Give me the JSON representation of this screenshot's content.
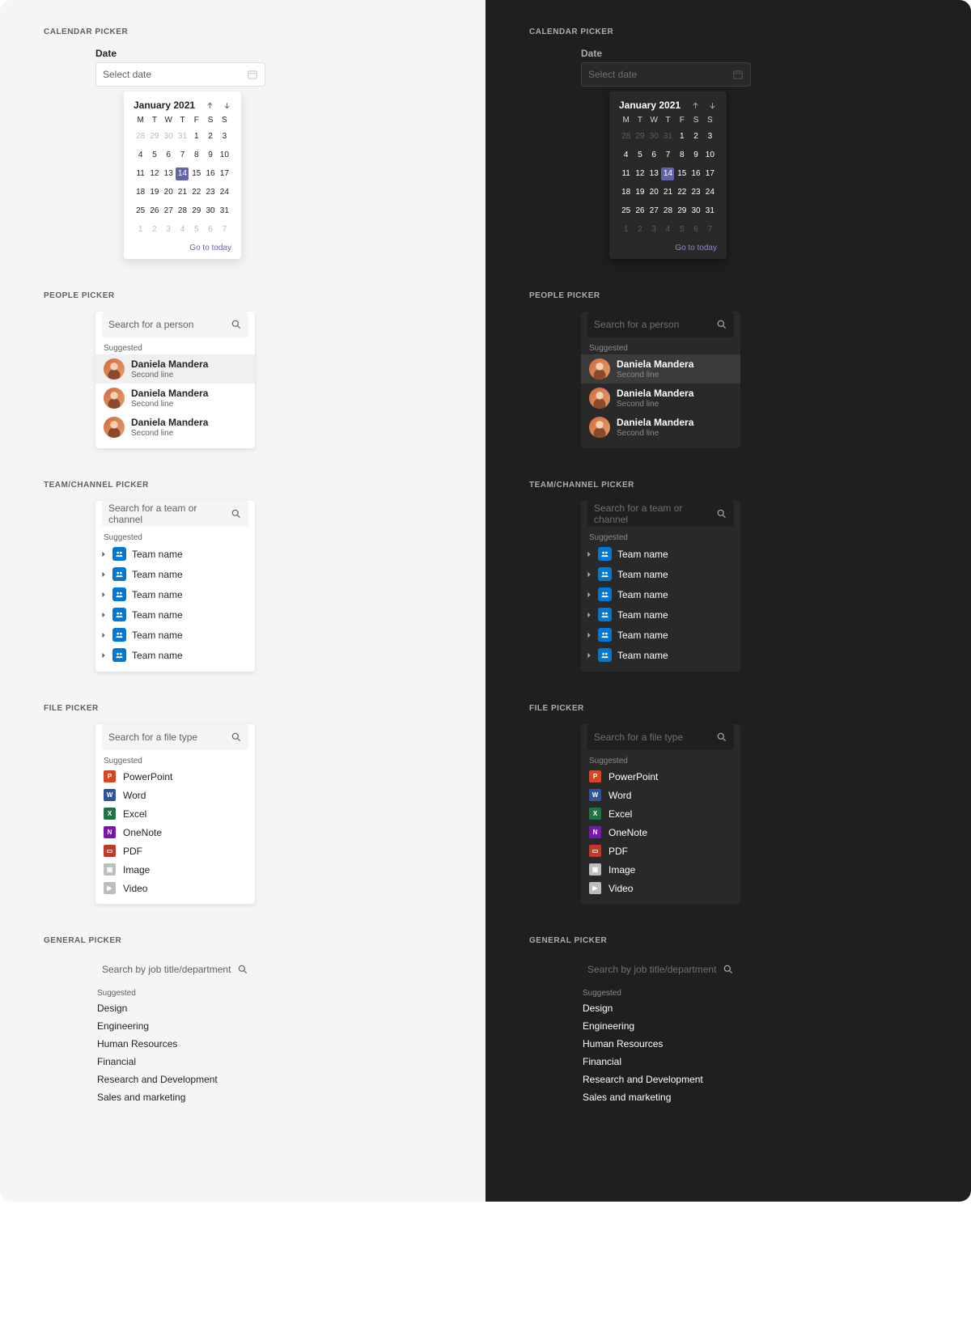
{
  "sections": {
    "calendar": "CALENDAR PICKER",
    "people": "PEOPLE PICKER",
    "team": "TEAM/CHANNEL PICKER",
    "file": "FILE PICKER",
    "general": "GENERAL PICKER"
  },
  "calendar": {
    "label": "Date",
    "placeholder": "Select date",
    "month": "January 2021",
    "dow": [
      "M",
      "T",
      "W",
      "T",
      "F",
      "S",
      "S"
    ],
    "weeks": [
      [
        {
          "n": 28,
          "o": 1
        },
        {
          "n": 29,
          "o": 1
        },
        {
          "n": 30,
          "o": 1
        },
        {
          "n": 31,
          "o": 1
        },
        {
          "n": 1
        },
        {
          "n": 2
        },
        {
          "n": 3
        }
      ],
      [
        {
          "n": 4
        },
        {
          "n": 5
        },
        {
          "n": 6
        },
        {
          "n": 7
        },
        {
          "n": 8
        },
        {
          "n": 9
        },
        {
          "n": 10
        }
      ],
      [
        {
          "n": 11
        },
        {
          "n": 12
        },
        {
          "n": 13
        },
        {
          "n": 14,
          "s": 1
        },
        {
          "n": 15
        },
        {
          "n": 16
        },
        {
          "n": 17
        }
      ],
      [
        {
          "n": 18
        },
        {
          "n": 19
        },
        {
          "n": 20
        },
        {
          "n": 21
        },
        {
          "n": 22
        },
        {
          "n": 23
        },
        {
          "n": 24
        }
      ],
      [
        {
          "n": 25
        },
        {
          "n": 26
        },
        {
          "n": 27
        },
        {
          "n": 28
        },
        {
          "n": 29
        },
        {
          "n": 30
        },
        {
          "n": 31
        }
      ],
      [
        {
          "n": 1,
          "o": 1
        },
        {
          "n": 2,
          "o": 1
        },
        {
          "n": 3,
          "o": 1
        },
        {
          "n": 4,
          "o": 1
        },
        {
          "n": 5,
          "o": 1
        },
        {
          "n": 6,
          "o": 1
        },
        {
          "n": 7,
          "o": 1
        }
      ]
    ],
    "go_today": "Go to today"
  },
  "people": {
    "placeholder": "Search for a person",
    "suggested": "Suggested",
    "items": [
      {
        "name": "Daniela Mandera",
        "sub": "Second line",
        "hi": 1
      },
      {
        "name": "Daniela Mandera",
        "sub": "Second line"
      },
      {
        "name": "Daniela Mandera",
        "sub": "Second line"
      }
    ]
  },
  "team": {
    "placeholder": "Search for a team or channel",
    "suggested": "Suggested",
    "items": [
      "Team name",
      "Team name",
      "Team name",
      "Team name",
      "Team name",
      "Team name"
    ]
  },
  "file": {
    "placeholder": "Search for a file type",
    "suggested": "Suggested",
    "items": [
      {
        "label": "PowerPoint",
        "bg": "#d24726",
        "t": "P"
      },
      {
        "label": "Word",
        "bg": "#2b579a",
        "t": "W"
      },
      {
        "label": "Excel",
        "bg": "#217346",
        "t": "X"
      },
      {
        "label": "OneNote",
        "bg": "#7719aa",
        "t": "N"
      },
      {
        "label": "PDF",
        "bg": "#c1392b",
        "t": "▭"
      },
      {
        "label": "Image",
        "bg": "#bdbdbd",
        "t": "▣"
      },
      {
        "label": "Video",
        "bg": "#bdbdbd",
        "t": "▶"
      }
    ]
  },
  "general": {
    "placeholder": "Search by job title/department",
    "suggested": "Suggested",
    "items": [
      "Design",
      "Engineering",
      "Human Resources",
      "Financial",
      "Research and Development",
      "Sales and marketing"
    ]
  }
}
